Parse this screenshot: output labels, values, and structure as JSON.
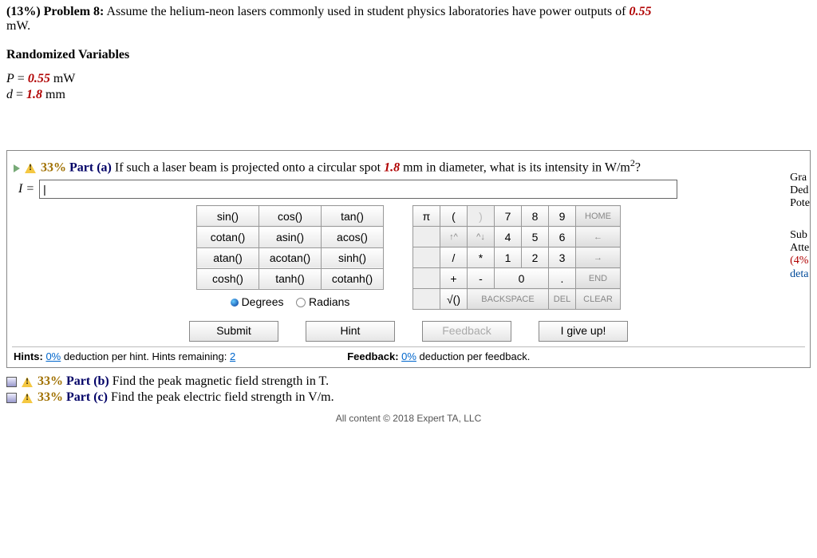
{
  "problem": {
    "percent": "(13%)",
    "label": "Problem 8:",
    "text1": "Assume the helium-neon lasers commonly used in student physics laboratories have power outputs of ",
    "power": "0.55",
    "unit": "mW."
  },
  "random": {
    "heading": "Randomized Variables",
    "P_sym": "P",
    "P_val": "0.55",
    "P_unit": " mW",
    "d_sym": "d",
    "d_val": "1.8",
    "d_unit": " mm"
  },
  "part_a": {
    "pct": "33%",
    "label": "Part (a)",
    "q1": "  If such a laser beam is projected onto a circular spot ",
    "diam": "1.8",
    "q2": " mm in diameter, what is its intensity in W/m",
    "lhs": "I = ",
    "input_value": "|"
  },
  "side": {
    "s1": "Gra",
    "s2": "Ded",
    "s3": "Pote",
    "s4": "Sub",
    "s5": "Atte",
    "s6": "(4%",
    "s7": "deta"
  },
  "fn": {
    "r1c1": "sin()",
    "r1c2": "cos()",
    "r1c3": "tan()",
    "r2c1": "cotan()",
    "r2c2": "asin()",
    "r2c3": "acos()",
    "r3c1": "atan()",
    "r3c2": "acotan()",
    "r3c3": "sinh()",
    "r4c1": "cosh()",
    "r4c2": "tanh()",
    "r4c3": "cotanh()",
    "deg": "Degrees",
    "rad": "Radians"
  },
  "num": {
    "pi": "π",
    "lp": "(",
    "rp": ")",
    "n7": "7",
    "n8": "8",
    "n9": "9",
    "home": "HOME",
    "up": "↑^",
    "dn": "^↓",
    "n4": "4",
    "n5": "5",
    "n6": "6",
    "left": "←",
    "slash": "/",
    "star": "*",
    "n1": "1",
    "n2": "2",
    "n3": "3",
    "right": "→",
    "plus": "+",
    "minus": "-",
    "n0": "0",
    "dot": ".",
    "end": "END",
    "sqrt": "√()",
    "bksp": "BACKSPACE",
    "del": "DEL",
    "clear": "CLEAR"
  },
  "actions": {
    "submit": "Submit",
    "hint": "Hint",
    "feedback": "Feedback",
    "giveup": "I give up!"
  },
  "hints": {
    "h1a": "Hints: ",
    "h1b": "0%",
    "h1c": "  deduction per hint. Hints remaining: ",
    "h1d": "2",
    "fb1": "Feedback: ",
    "fb2": "0%",
    "fb3": "  deduction per feedback."
  },
  "part_b": {
    "pct": "33%",
    "label": "Part (b)",
    "txt": "  Find the peak magnetic field strength in T."
  },
  "part_c": {
    "pct": "33%",
    "label": "Part (c)",
    "txt": "  Find the peak electric field strength in V/m."
  },
  "footer": "All content © 2018 Expert TA, LLC"
}
